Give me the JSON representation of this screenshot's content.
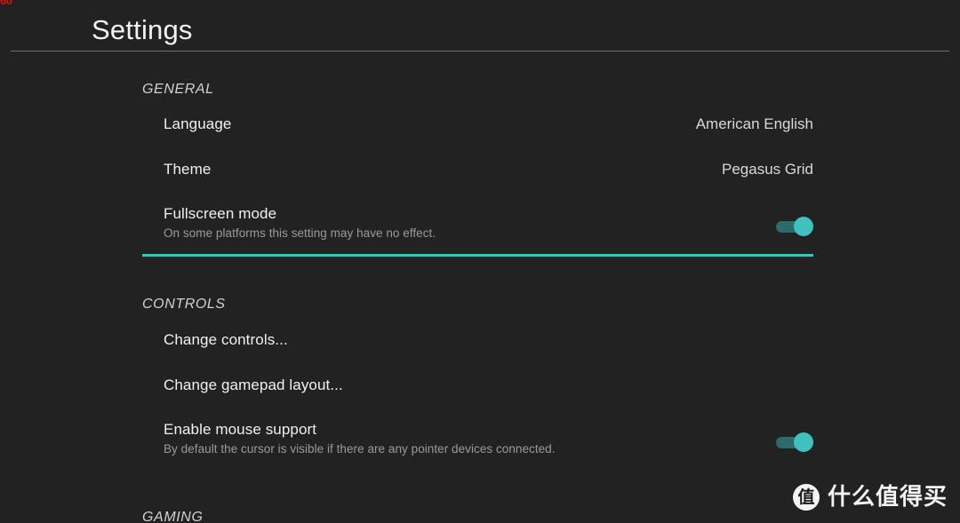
{
  "overlay": {
    "fps_counter": "60"
  },
  "header": {
    "title": "Settings"
  },
  "theme_colors": {
    "background": "#222222",
    "accent": "#3fc1c0",
    "accent_track": "#2d6a6a",
    "text_primary": "#f0f0f0",
    "text_secondary": "#9a9a9a",
    "divider": "#6e6e6e"
  },
  "sections": [
    {
      "id": "general",
      "header": "GENERAL",
      "rows": [
        {
          "id": "language",
          "label": "Language",
          "value": "American English",
          "type": "value",
          "note": null,
          "selected": false
        },
        {
          "id": "theme",
          "label": "Theme",
          "value": "Pegasus Grid",
          "type": "value",
          "note": null,
          "selected": false
        },
        {
          "id": "fullscreen-mode",
          "label": "Fullscreen mode",
          "note": "On some platforms this setting may have no effect.",
          "type": "toggle",
          "toggle_state": "on",
          "selected": true
        }
      ]
    },
    {
      "id": "controls",
      "header": "CONTROLS",
      "rows": [
        {
          "id": "change-controls",
          "label": "Change controls...",
          "type": "action",
          "note": null,
          "selected": false
        },
        {
          "id": "change-gamepad-layout",
          "label": "Change gamepad layout...",
          "type": "action",
          "note": null,
          "selected": false
        },
        {
          "id": "enable-mouse-support",
          "label": "Enable mouse support",
          "note": "By default the cursor is visible if there are any pointer devices connected.",
          "type": "toggle",
          "toggle_state": "on",
          "selected": false
        }
      ]
    },
    {
      "id": "gaming",
      "header": "GAMING",
      "rows": []
    }
  ],
  "watermark": {
    "logo_glyph": "值",
    "text": "什么值得买"
  }
}
